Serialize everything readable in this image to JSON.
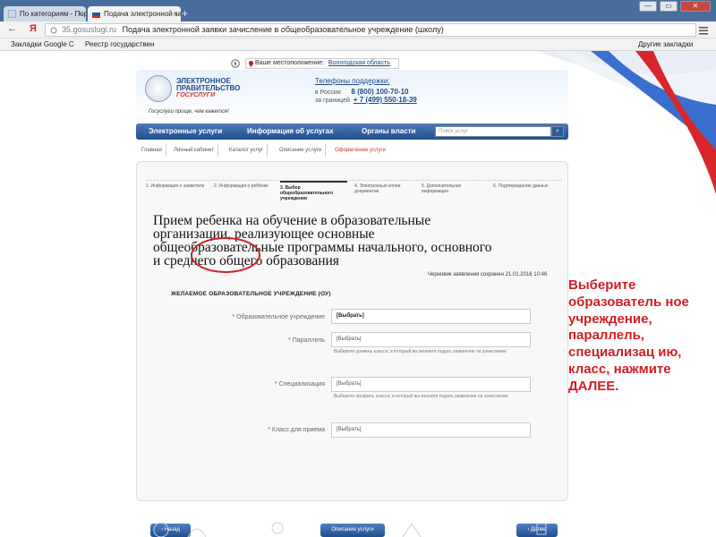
{
  "browser": {
    "tabs": [
      {
        "title": "По категориям - Порта"
      },
      {
        "title": "Подача электронной за"
      }
    ],
    "new_tab": "+",
    "window_buttons": [
      "—",
      "▭",
      "✕"
    ],
    "back": "←",
    "yandex": "Я",
    "url_host": "35.gosuslugi.ru",
    "page_title": "Подача электронной заявки зачисление в общеобразовательное учреждение (школу)",
    "bookmarks": [
      "Закладки Google C",
      "Реестр государствен"
    ],
    "other_bookmarks": "Другие закладки"
  },
  "portal": {
    "location_label": "Ваше местоположение:",
    "location_value": "Вологодская область",
    "brand_line1": "ЭЛЕКТРОННОЕ",
    "brand_line2": "ПРАВИТЕЛЬСТВО",
    "brand_line3": "ГОСУСЛУГИ",
    "slogan": "Госуслуги проще, чем кажется!",
    "phones_title": "Телефоны поддержки:",
    "phone_ru_label": "в России",
    "phone_ru": "8 (800) 100-70-10",
    "phone_abroad_label": "за границей",
    "phone_abroad": "+ 7 (499) 550-18-39",
    "menu": [
      "Электронные услуги",
      "Информация об услугах",
      "Органы власти"
    ],
    "search_placeholder": "Поиск услуг",
    "breadcrumbs": [
      "Главная",
      "Личный кабинет",
      "Каталог услуг",
      "Описание услуги",
      "Оформление услуги"
    ]
  },
  "form": {
    "steps": [
      "1. Информация о заявителе",
      "2. Информация о ребёнке",
      "3. Выбор общеобразовательного учреждения",
      "4. Электронные копии документов",
      "5. Дополнительная информация",
      "6. Подтверждение данных"
    ],
    "heading": "Прием ребенка на обучение в образовательные организации, реализующее основные общеобразовательные программы начального, основного и среднего общего образования",
    "draft_saved": "Черновик заявления сохранен 21.01.2016 10:46",
    "section_title": "ЖЕЛАЕМОЕ ОБРАЗОВАТЕЛЬНОЕ УЧРЕЖДЕНИЕ (ОУ)",
    "fields": [
      {
        "label": "Образовательное учреждение",
        "value": "[Выбрать]",
        "hint": ""
      },
      {
        "label": "Параллель",
        "value": "[Выбрать]",
        "hint": "Выберите уровень класса, в который вы желаете подать заявление на зачисление"
      },
      {
        "label": "Специализация",
        "value": "[Выбрать]",
        "hint": "Выберите профиль класса, в который вы желаете подать заявление на зачисление"
      },
      {
        "label": "Класс для приема",
        "value": "[Выбрать]",
        "hint": ""
      }
    ],
    "btn_back": "‹  Назад",
    "btn_desc": "Описание услуги",
    "btn_next": "›  Далее"
  },
  "instruction": "Выберите образователь ное учреждение, параллель, специализац ию, класс, нажмите ДАЛЕЕ.",
  "colors": {
    "accent": "#1f4f8f",
    "instruction": "#d01e24"
  }
}
